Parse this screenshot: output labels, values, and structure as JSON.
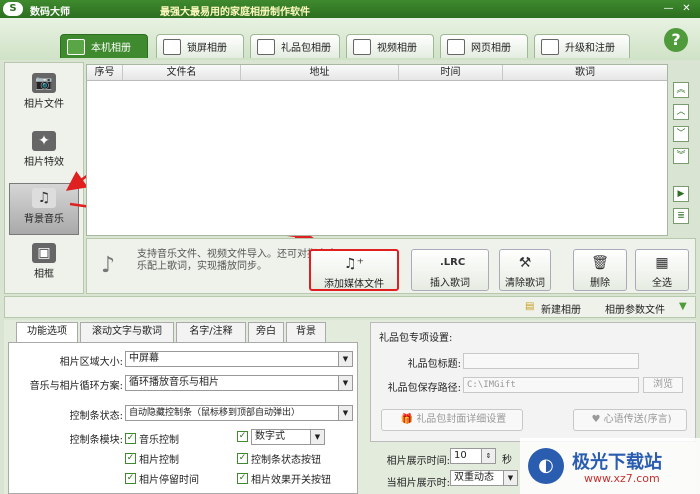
{
  "title": {
    "app_name": "数码大师",
    "slogan": "最强大最易用的家庭相册制作软件",
    "logo_letter": "S",
    "minimize": "—",
    "close": "✕"
  },
  "tabs": [
    {
      "label": "本机相册",
      "active": true
    },
    {
      "label": "锁屏相册"
    },
    {
      "label": "礼品包相册"
    },
    {
      "label": "视频相册"
    },
    {
      "label": "网页相册"
    },
    {
      "label": "升级和注册"
    }
  ],
  "help_label": "?",
  "sidebar": {
    "items": [
      {
        "label": "相片文件",
        "icon": "camera-icon",
        "glyph": "📷"
      },
      {
        "label": "相片特效",
        "icon": "effects-icon",
        "glyph": "✦"
      },
      {
        "label": "背景音乐",
        "icon": "music-icon",
        "glyph": "♫",
        "selected": true
      },
      {
        "label": "相框",
        "icon": "frame-icon",
        "glyph": "▣"
      }
    ]
  },
  "table": {
    "columns": [
      "序号",
      "文件名",
      "地址",
      "时间",
      "歌词"
    ]
  },
  "scroll_buttons": [
    "︽",
    "︿",
    "﹀",
    "︾",
    "▶",
    "≣"
  ],
  "actions": {
    "note": "支持音乐文件、视频文件导入。还可对指定音乐配上歌词，实现播放同步。",
    "add_media": "添加媒体文件",
    "insert_lyrics": "插入歌词",
    "lrc_label": ".LRC",
    "clear_lyrics": "清除歌词",
    "delete": "删除",
    "select_all": "全选"
  },
  "midbar": {
    "new_album": "新建相册",
    "album_params": "相册参数文件"
  },
  "subtabs": [
    "功能选项",
    "滚动文字与歌词",
    "名字/注释",
    "旁白",
    "背景"
  ],
  "options": {
    "area_size_label": "相片区域大小:",
    "area_size_value": "中屏幕",
    "loop_label": "音乐与相片循环方案:",
    "loop_value": "循环播放音乐与相片",
    "ctrlbar_state_label": "控制条状态:",
    "ctrlbar_state_value": "自动隐藏控制条（鼠标移到顶部自动弹出）",
    "ctrlbar_modules_label": "控制条模块:",
    "modules": [
      "音乐控制",
      "数字式",
      "相片控制",
      "控制条状态按钮",
      "相片停留时间",
      "相片效果开关按钮"
    ]
  },
  "gift": {
    "header": "礼品包专项设置:",
    "title_label": "礼品包标题:",
    "title_value": "",
    "path_label": "礼品包保存路径:",
    "path_value": "C:\\IMGift",
    "browse": "浏览",
    "cover_btn": "礼品包封面详细设置",
    "message_btn": "心语传送(序言)"
  },
  "timing": {
    "display_time_label": "相片展示时间:",
    "display_time_value": "10",
    "unit": "秒",
    "display_mode_label": "当相片展示时:",
    "display_mode_value": "双重动态"
  },
  "watermark": {
    "brand": "极光下载站",
    "url": "www.xz7.com"
  }
}
